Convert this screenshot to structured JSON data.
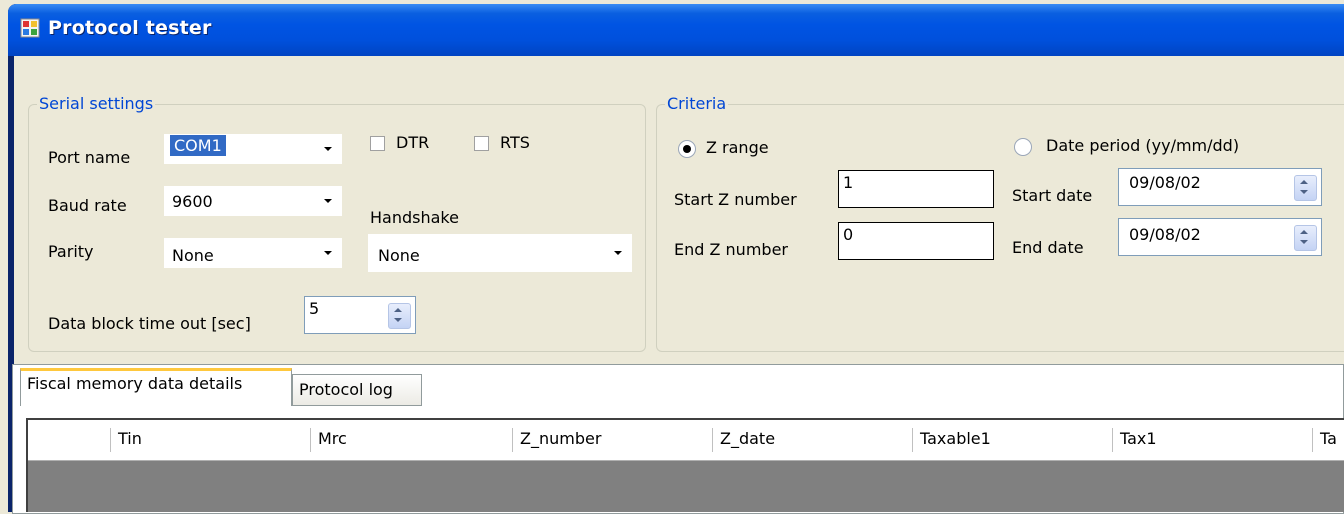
{
  "window": {
    "title": "Protocol tester",
    "icon": "app-window-icon"
  },
  "serial": {
    "group_title": "Serial settings",
    "port_label": "Port name",
    "port_value": "COM1",
    "baud_label": "Baud rate",
    "baud_value": "9600",
    "parity_label": "Parity",
    "parity_value": "None",
    "dtr_label": "DTR",
    "rts_label": "RTS",
    "handshake_label": "Handshake",
    "handshake_value": "None",
    "timeout_label": "Data block time out [sec]",
    "timeout_value": "5"
  },
  "criteria": {
    "group_title": "Criteria",
    "z_range_label": "Z range",
    "z_range_selected": true,
    "date_period_label": "Date period (yy/mm/dd)",
    "start_z_label": "Start Z number",
    "start_z_value": "1",
    "end_z_label": "End Z number",
    "end_z_value": "0",
    "start_date_label": "Start date",
    "start_date_value": "09/08/02",
    "end_date_label": "End date",
    "end_date_value": "09/08/02"
  },
  "tabs": [
    {
      "label": "Fiscal memory data details",
      "active": true
    },
    {
      "label": "Protocol log",
      "active": false
    }
  ],
  "grid": {
    "columns": [
      "Tin",
      "Mrc",
      "Z_number",
      "Z_date",
      "Taxable1",
      "Tax1",
      "Ta"
    ]
  },
  "colors": {
    "titlebar": "#0054e3",
    "group_title": "#0046d5",
    "selection": "#316ac5",
    "active_tab": "#ffc83d"
  }
}
